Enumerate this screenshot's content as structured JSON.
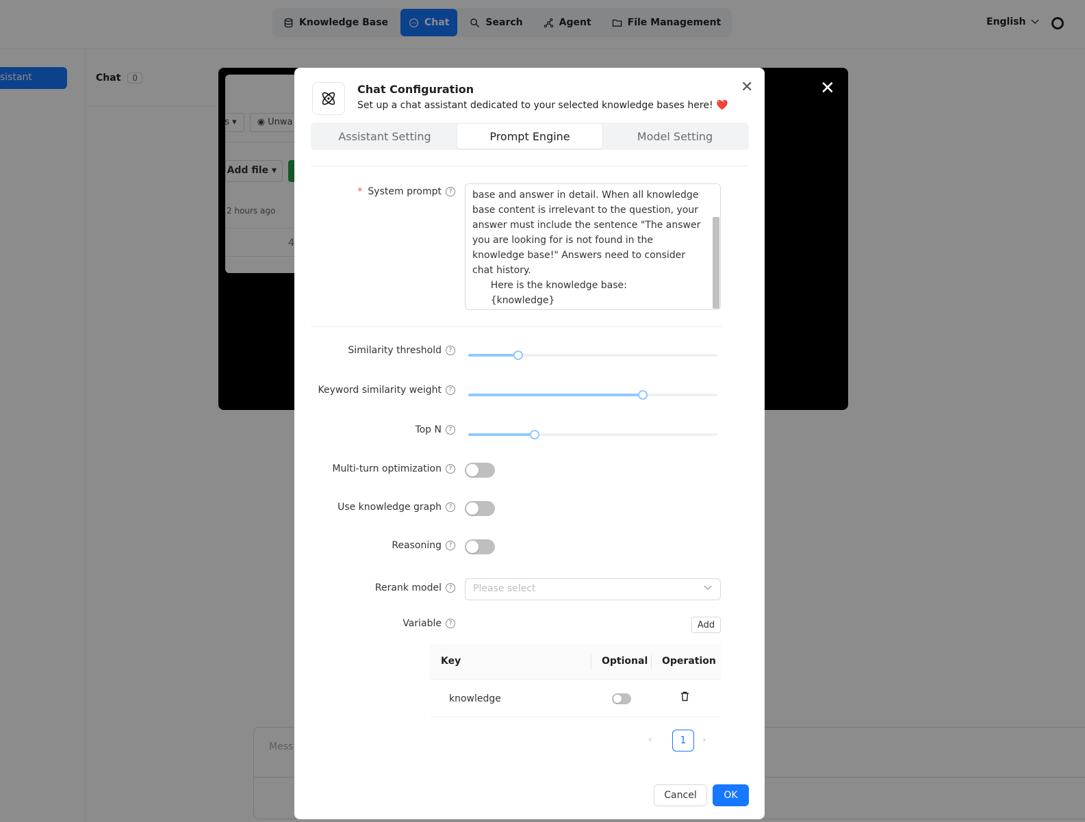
{
  "topnav": {
    "items": [
      {
        "label": "Knowledge Base",
        "icon": "database-icon",
        "active": false
      },
      {
        "label": "Chat",
        "icon": "chat-icon",
        "active": true
      },
      {
        "label": "Search",
        "icon": "search-icon",
        "active": false
      },
      {
        "label": "Agent",
        "icon": "agent-icon",
        "active": false
      },
      {
        "label": "File Management",
        "icon": "folder-icon",
        "active": false
      }
    ],
    "language": "English",
    "accent": "#1677ff"
  },
  "background": {
    "assistant_button": "sistant",
    "chat_label": "Chat",
    "chat_count": "0",
    "message_placeholder": "Mess",
    "card": {
      "chip1": "ns",
      "chip2": "Unwa",
      "add_file": "Add file",
      "time_ago": "2 hours ago",
      "digit": "4"
    }
  },
  "modal": {
    "title": "Chat Configuration",
    "subtitle": "Set up a chat assistant dedicated to your selected knowledge bases here! ❤️",
    "tabs": [
      {
        "label": "Assistant Setting",
        "active": false
      },
      {
        "label": "Prompt Engine",
        "active": true
      },
      {
        "label": "Model Setting",
        "active": false
      }
    ],
    "system_prompt": {
      "label": "System prompt",
      "required": true,
      "value": "base and answer in detail. When all knowledge base content is irrelevant to the question, your answer must include the sentence \"The answer you are looking for is not found in the knowledge base!\" Answers need to consider chat history.\n      Here is the knowledge base:\n      {knowledge}\n      The above is the knowledge base."
    },
    "sliders": [
      {
        "label": "Similarity threshold",
        "value_fraction": 0.2
      },
      {
        "label": "Keyword similarity weight",
        "value_fraction": 0.7
      },
      {
        "label": "Top N",
        "value_fraction": 0.267
      }
    ],
    "toggles": [
      {
        "label": "Multi-turn optimization",
        "on": false
      },
      {
        "label": "Use knowledge graph",
        "on": false
      },
      {
        "label": "Reasoning",
        "on": false
      }
    ],
    "rerank": {
      "label": "Rerank model",
      "placeholder": "Please select"
    },
    "variable": {
      "label": "Variable",
      "add_label": "Add",
      "columns": [
        "Key",
        "Optional",
        "Operation"
      ],
      "rows": [
        {
          "key": "knowledge",
          "optional": false
        }
      ]
    },
    "pagination": {
      "current": "1"
    },
    "footer": {
      "cancel": "Cancel",
      "ok": "OK"
    }
  }
}
